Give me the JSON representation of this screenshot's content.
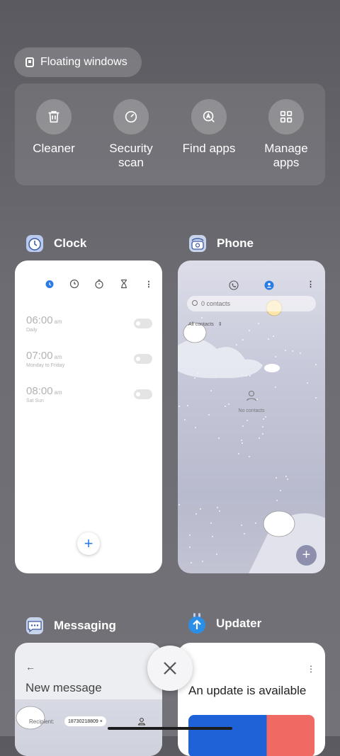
{
  "floating": {
    "label": "Floating windows",
    "icon": "floating-window-icon"
  },
  "quick_actions": [
    {
      "label": "Cleaner",
      "icon": "trash-icon"
    },
    {
      "label": "Security scan",
      "line1": "Security",
      "line2": "scan",
      "icon": "security-scan-icon"
    },
    {
      "label": "Find apps",
      "icon": "find-apps-icon"
    },
    {
      "label": "Manage apps",
      "line1": "Manage",
      "line2": "apps",
      "icon": "grid-icon"
    }
  ],
  "apps": {
    "clock": {
      "name": "Clock",
      "alarms": [
        {
          "time": "06:00",
          "ampm": "am",
          "repeat": "Daily",
          "enabled": false
        },
        {
          "time": "07:00",
          "ampm": "am",
          "repeat": "Monday to Friday",
          "enabled": false
        },
        {
          "time": "08:00",
          "ampm": "am",
          "repeat": "Sat Sun",
          "enabled": false
        }
      ],
      "add_label": "+"
    },
    "phone": {
      "name": "Phone",
      "search_placeholder": "0 contacts",
      "filter_label": "All contacts",
      "empty_label": "No contacts",
      "add_label": "+"
    },
    "messaging": {
      "name": "Messaging",
      "back_label": "←",
      "title": "New message",
      "recipient_label": "Recipient:",
      "recipient_chip": "18730218809 ×"
    },
    "updater": {
      "name": "Updater",
      "title": "An update is available",
      "menu_label": "⋮"
    }
  },
  "close_label": "×",
  "colors": {
    "accent_blue": "#2c7be5",
    "updater_blue": "#1f62d8",
    "updater_coral": "#f06a63"
  }
}
